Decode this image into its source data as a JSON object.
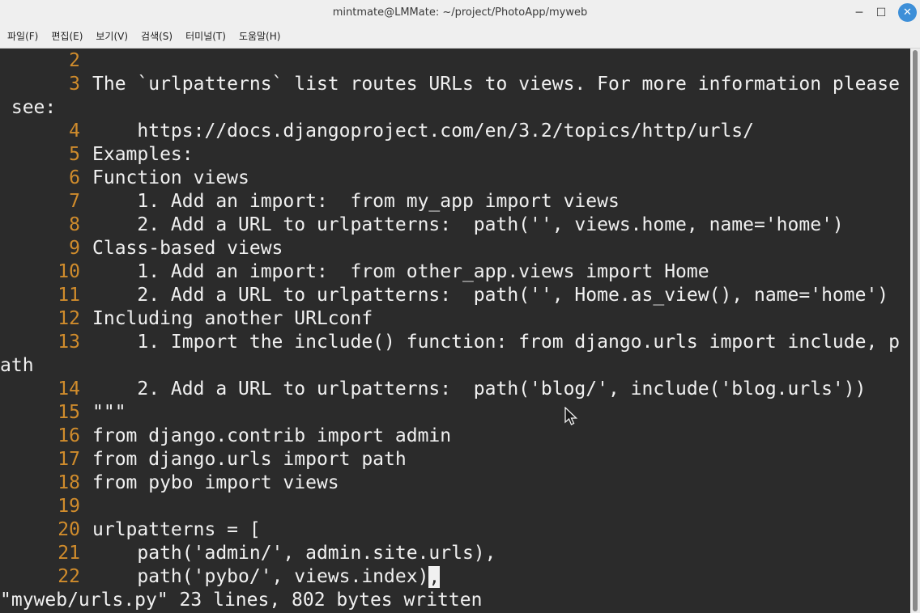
{
  "window": {
    "title": "mintmate@LMMate: ~/project/PhotoApp/myweb",
    "minimize_label": "─",
    "maximize_label": "☐",
    "close_label": "✕"
  },
  "menu": {
    "items": [
      {
        "label": "파일(F)"
      },
      {
        "label": "편집(E)"
      },
      {
        "label": "보기(V)"
      },
      {
        "label": "검색(S)"
      },
      {
        "label": "터미널(T)"
      },
      {
        "label": "도움말(H)"
      }
    ]
  },
  "terminal": {
    "lines": [
      {
        "num": "2",
        "text": ""
      },
      {
        "num": "3",
        "text": "The `urlpatterns` list routes URLs to views. For more information please"
      },
      {
        "num": "",
        "text": " see:"
      },
      {
        "num": "4",
        "text": "    https://docs.djangoproject.com/en/3.2/topics/http/urls/"
      },
      {
        "num": "5",
        "text": "Examples:"
      },
      {
        "num": "6",
        "text": "Function views"
      },
      {
        "num": "7",
        "text": "    1. Add an import:  from my_app import views"
      },
      {
        "num": "8",
        "text": "    2. Add a URL to urlpatterns:  path('', views.home, name='home')"
      },
      {
        "num": "9",
        "text": "Class-based views"
      },
      {
        "num": "10",
        "text": "    1. Add an import:  from other_app.views import Home"
      },
      {
        "num": "11",
        "text": "    2. Add a URL to urlpatterns:  path('', Home.as_view(), name='home')"
      },
      {
        "num": "12",
        "text": "Including another URLconf"
      },
      {
        "num": "13",
        "text": "    1. Import the include() function: from django.urls import include, p"
      },
      {
        "num": "",
        "text": "ath"
      },
      {
        "num": "14",
        "text": "    2. Add a URL to urlpatterns:  path('blog/', include('blog.urls'))"
      },
      {
        "num": "15",
        "text": "\"\"\""
      },
      {
        "num": "16",
        "text": "from django.contrib import admin"
      },
      {
        "num": "17",
        "text": "from django.urls import path"
      },
      {
        "num": "18",
        "text": "from pybo import views"
      },
      {
        "num": "19",
        "text": ""
      },
      {
        "num": "20",
        "text": "urlpatterns = ["
      },
      {
        "num": "21",
        "text": "    path('admin/', admin.site.urls),"
      },
      {
        "num": "22",
        "text": "    path('pybo/', views.index)"
      }
    ],
    "cursor_char": ",",
    "status_line": "\"myweb/urls.py\" 23 lines, 802 bytes written"
  },
  "colors": {
    "background": "#2b2b2b",
    "text": "#f0f0f0",
    "line_number": "#d08c2c",
    "titlebar": "#efefef",
    "close_button": "#3d8fd8"
  }
}
